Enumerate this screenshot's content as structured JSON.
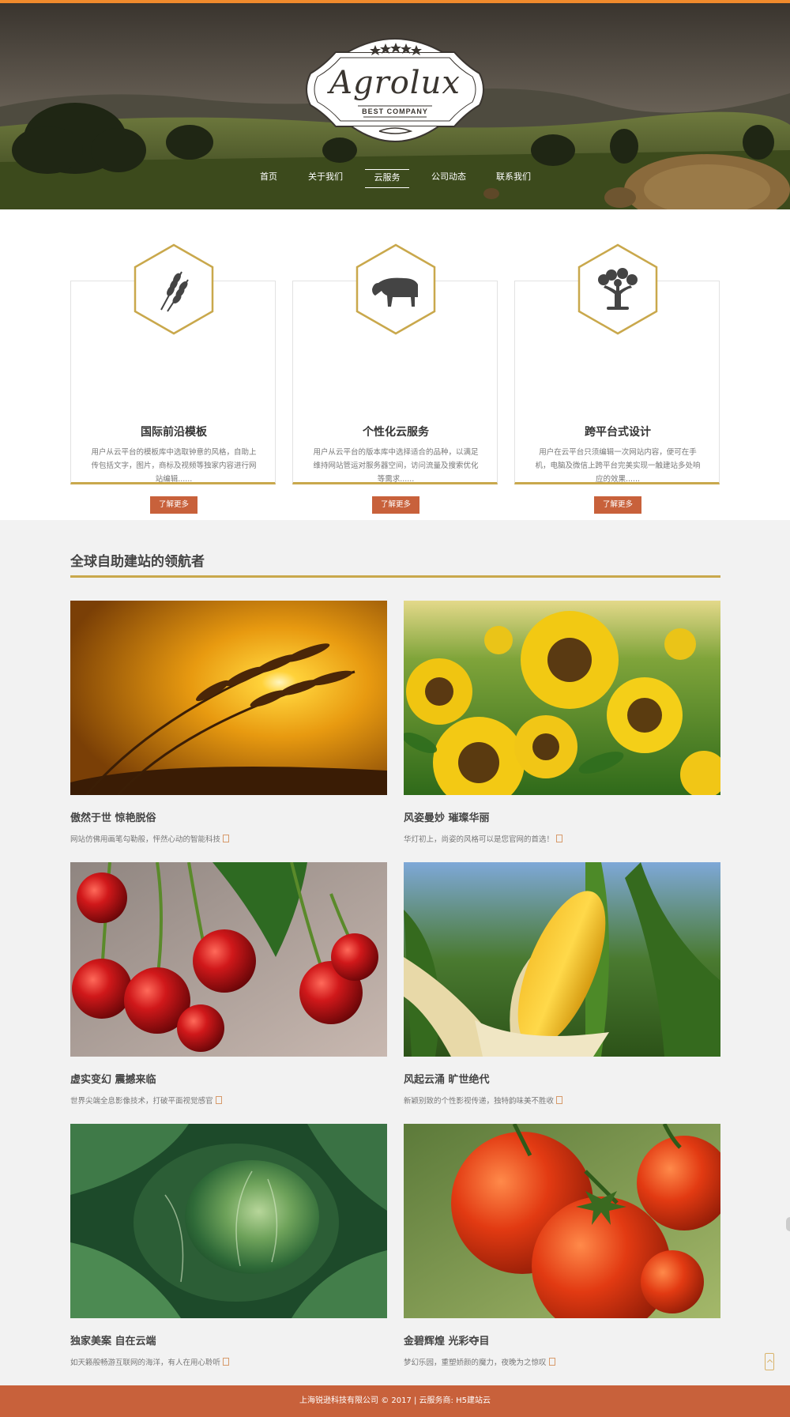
{
  "header": {
    "logo_title": "Agrolux",
    "logo_subtitle": "BEST COMPANY",
    "nav": [
      {
        "label": "首页"
      },
      {
        "label": "关于我们"
      },
      {
        "label": "云服务"
      },
      {
        "label": "公司动态"
      },
      {
        "label": "联系我们"
      }
    ],
    "active_nav": "云服务"
  },
  "services": [
    {
      "icon": "wheat-icon",
      "title": "国际前沿模板",
      "desc": "用户从云平台的模板库中选取钟意的风格，自助上传包括文字，图片，商标及视频等独家内容进行网站编辑......",
      "button": "了解更多"
    },
    {
      "icon": "cow-icon",
      "title": "个性化云服务",
      "desc": "用户从云平台的版本库中选择适合的品种，以满足维持网站管运对服务器空间，访问流量及搜索优化等需求......",
      "button": "了解更多"
    },
    {
      "icon": "tree-icon",
      "title": "跨平台式设计",
      "desc": "用户在云平台只须编辑一次网站内容，便可在手机，电脑及微信上跨平台完美实现一触建站多处响应的效果......",
      "button": "了解更多"
    }
  ],
  "gallery": {
    "title": "全球自助建站的领航者",
    "items": [
      {
        "image": "wheat-sunset-image",
        "title": "傲然于世 惊艳脱俗",
        "desc": "网站仿佛用画笔勾勒般，怦然心动的智能科技"
      },
      {
        "image": "sunflowers-image",
        "title": "风姿曼妙 璀璨华丽",
        "desc": "华灯初上，尚姿的风格可以是您官网的首选！"
      },
      {
        "image": "cherries-image",
        "title": "虚实变幻 震撼来临",
        "desc": "世界尖端全息影像技术，打破平面视觉感官"
      },
      {
        "image": "corn-image",
        "title": "风起云涌 旷世绝代",
        "desc": "新颖别致的个性影视传递，独特韵味美不胜收"
      },
      {
        "image": "cabbage-image",
        "title": "独家美案 自在云端",
        "desc": "如天籁般畅游互联网的海洋，有人在用心聆听"
      },
      {
        "image": "tomatoes-image",
        "title": "金碧辉煌 光彩夺目",
        "desc": "梦幻乐园，重塑娇颜的魔力，夜晚为之惊叹"
      }
    ]
  },
  "footer": {
    "text": "上海锐逊科技有限公司 © 2017 | 云服务商: H5建站云"
  },
  "colors": {
    "accent_orange": "#c8613b",
    "gold": "#c9a84c",
    "top_line": "#f08a2c",
    "gallery_bg": "#f2f2f2"
  }
}
